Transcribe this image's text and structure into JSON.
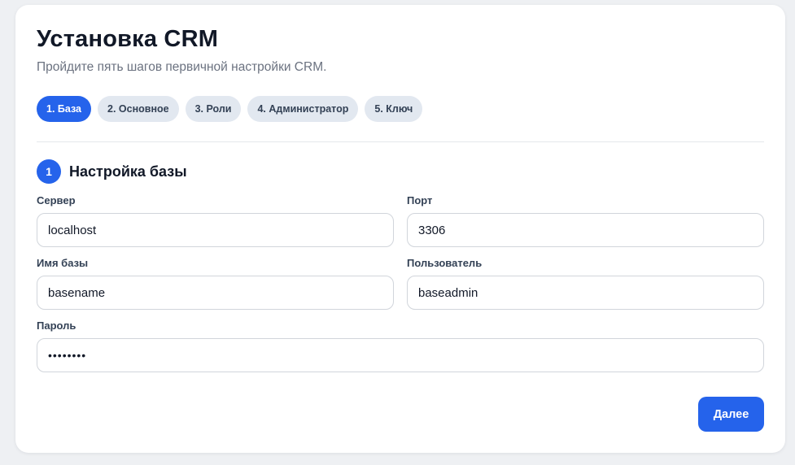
{
  "header": {
    "title": "Установка CRM",
    "subtitle": "Пройдите пять шагов первичной настройки CRM."
  },
  "steps": [
    {
      "label": "1. База",
      "active": true
    },
    {
      "label": "2. Основное",
      "active": false
    },
    {
      "label": "3. Роли",
      "active": false
    },
    {
      "label": "4. Администратор",
      "active": false
    },
    {
      "label": "5. Ключ",
      "active": false
    }
  ],
  "section": {
    "number": "1",
    "title": "Настройка базы"
  },
  "form": {
    "server": {
      "label": "Сервер",
      "value": "localhost"
    },
    "port": {
      "label": "Порт",
      "value": "3306"
    },
    "db_name": {
      "label": "Имя базы",
      "value": "basename"
    },
    "user": {
      "label": "Пользователь",
      "value": "baseadmin"
    },
    "password": {
      "label": "Пароль",
      "value": "••••••••"
    }
  },
  "actions": {
    "next_label": "Далее"
  },
  "colors": {
    "accent": "#2563eb",
    "step_inactive_bg": "#e2e8f0",
    "background": "#eef0f3"
  }
}
